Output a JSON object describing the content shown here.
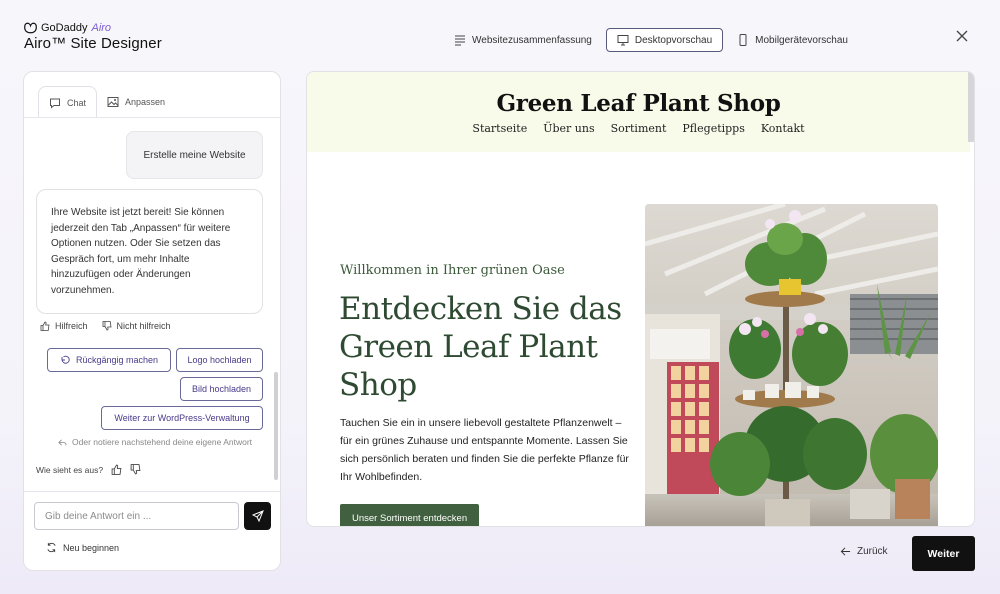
{
  "brand": {
    "company": "GoDaddy",
    "product": "Airo",
    "title": "Airo™ Site Designer"
  },
  "topnav": {
    "summary": "Websitezusammenfassung",
    "desktop": "Desktopvorschau",
    "mobile": "Mobilgerätevorschau"
  },
  "panel": {
    "tabs": {
      "chat": "Chat",
      "customize": "Anpassen"
    },
    "user_message": "Erstelle meine Website",
    "ai_message": "Ihre Website ist jetzt bereit! Sie können jederzeit den Tab „Anpassen“ für weitere Optionen nutzen. Oder Sie setzen das Gespräch fort, um mehr Inhalte hinzuzufügen oder Änderungen vorzunehmen.",
    "feedback": {
      "helpful": "Hilfreich",
      "not_helpful": "Nicht hilfreich"
    },
    "chips": {
      "undo": "Rückgängig machen",
      "upload_logo": "Logo hochladen",
      "upload_image": "Bild hochladen",
      "wordpress": "Weiter zur WordPress-Verwaltung"
    },
    "hint": "Oder notiere nachstehend deine eigene Antwort",
    "rating_question": "Wie sieht es aus?",
    "input_placeholder": "Gib deine Antwort ein ...",
    "restart": "Neu beginnen"
  },
  "preview": {
    "site_title": "Green Leaf Plant Shop",
    "nav": [
      "Startseite",
      "Über uns",
      "Sortiment",
      "Pflegetipps",
      "Kontakt"
    ],
    "kicker": "Willkommen in Ihrer grünen Oase",
    "hero_title": "Entdecken Sie das Green Leaf Plant Shop",
    "hero_text": "Tauchen Sie ein in unsere liebevoll gestaltete Pflanzenwelt – für ein grünes Zuhause und entspannte Momente. Lassen Sie sich persönlich beraten und finden Sie die perfekte Pflanze für Ihr Wohlbefinden.",
    "cta": "Unser Sortiment entdecken"
  },
  "footer": {
    "back": "Zurück",
    "next": "Weiter"
  },
  "colors": {
    "accent": "#7c5cd6",
    "brand_green": "#41603f",
    "header_bg": "#f8faea"
  },
  "icons": [
    "godaddy-logo-icon",
    "summary-lines-icon",
    "monitor-icon",
    "phone-icon",
    "close-icon",
    "chat-icon",
    "image-icon",
    "thumbs-up-icon",
    "thumbs-down-icon",
    "undo-icon",
    "reply-icon",
    "send-icon",
    "refresh-icon",
    "arrow-left-icon"
  ]
}
